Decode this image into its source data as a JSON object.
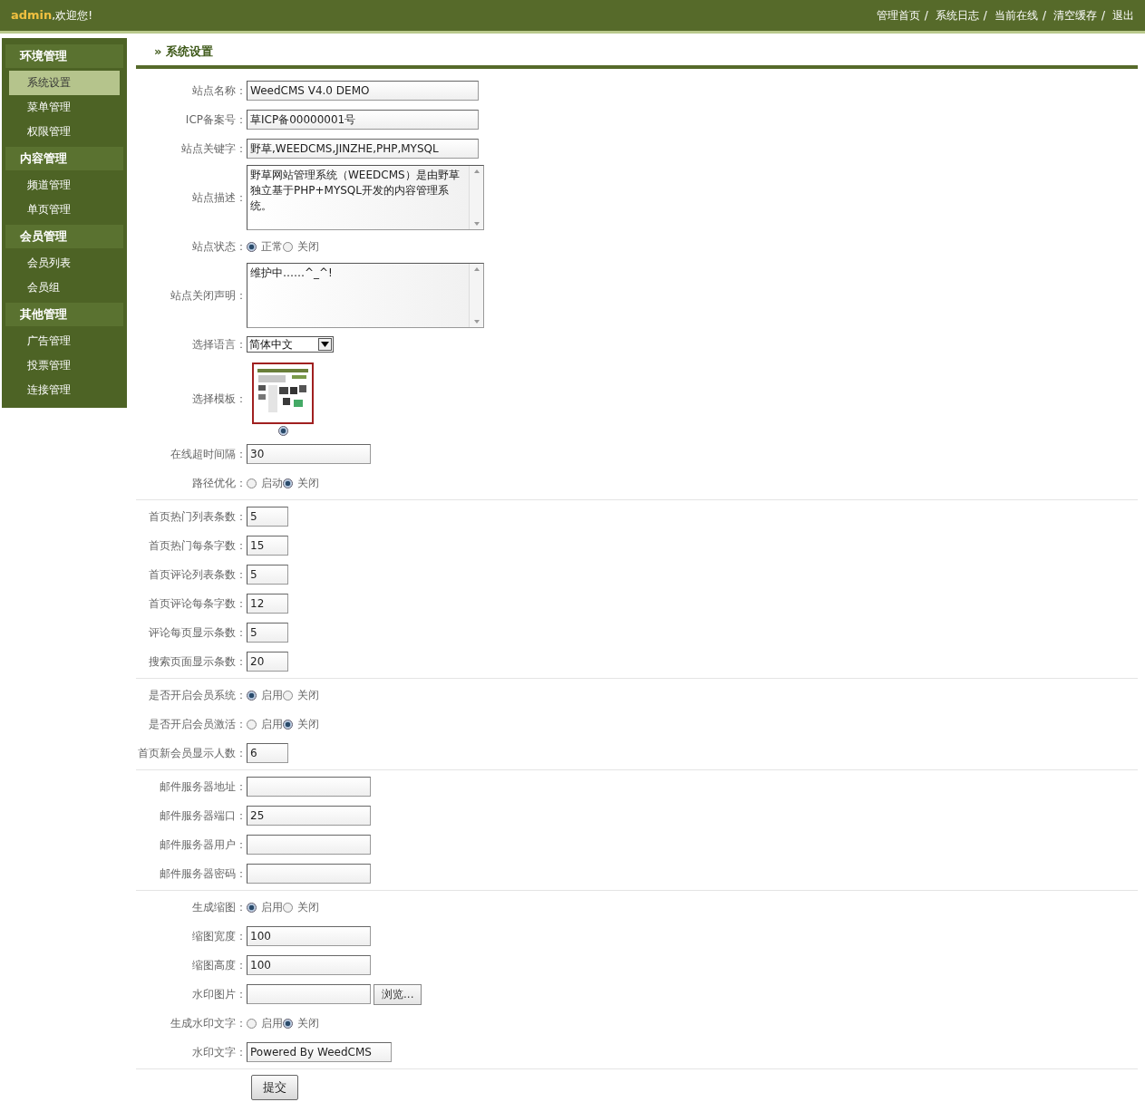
{
  "header": {
    "user": "admin",
    "greeting": ",欢迎您!",
    "links": [
      "管理首页",
      "系统日志",
      "当前在线",
      "清空缓存",
      "退出"
    ],
    "separator": "/"
  },
  "sidebar": {
    "groups": [
      {
        "title": "环境管理",
        "items": [
          {
            "label": "系统设置",
            "selected": true
          },
          {
            "label": "菜单管理",
            "selected": false
          },
          {
            "label": "权限管理",
            "selected": false
          }
        ]
      },
      {
        "title": "内容管理",
        "items": [
          {
            "label": "频道管理",
            "selected": false
          },
          {
            "label": "单页管理",
            "selected": false
          }
        ]
      },
      {
        "title": "会员管理",
        "items": [
          {
            "label": "会员列表",
            "selected": false
          },
          {
            "label": "会员组",
            "selected": false
          }
        ]
      },
      {
        "title": "其他管理",
        "items": [
          {
            "label": "广告管理",
            "selected": false
          },
          {
            "label": "投票管理",
            "selected": false
          },
          {
            "label": "连接管理",
            "selected": false
          }
        ]
      }
    ]
  },
  "page_title": "» 系统设置",
  "sections": [
    {
      "rows": [
        {
          "kind": "text",
          "label": "站点名称：",
          "value": "WeedCMS V4.0 DEMO"
        },
        {
          "kind": "text",
          "label": "ICP备案号：",
          "value": "草ICP备00000001号"
        },
        {
          "kind": "text",
          "label": "站点关键字：",
          "value": "野草,WEEDCMS,JINZHE,PHP,MYSQL"
        },
        {
          "kind": "textarea",
          "label": "站点描述：",
          "value": "野草网站管理系统（WEEDCMS）是由野草独立基于PHP+MYSQL开发的内容管理系统。"
        },
        {
          "kind": "radio",
          "label": "站点状态：",
          "options": [
            {
              "label": "正常",
              "selected": true
            },
            {
              "label": "关闭",
              "selected": false
            }
          ]
        },
        {
          "kind": "textarea",
          "label": "站点关闭声明：",
          "value": "维护中……^_^!"
        },
        {
          "kind": "select",
          "label": "选择语言：",
          "value": "简体中文"
        },
        {
          "kind": "template",
          "label": "选择模板：",
          "options": [
            {
              "selected": true
            }
          ]
        },
        {
          "kind": "text",
          "label": "在线超时间隔：",
          "value": "30"
        },
        {
          "kind": "radio",
          "label": "路径优化：",
          "options": [
            {
              "label": "启动",
              "selected": false
            },
            {
              "label": "关闭",
              "selected": true
            }
          ]
        }
      ]
    },
    {
      "rows": [
        {
          "kind": "text",
          "label": "首页热门列表条数：",
          "value": "5"
        },
        {
          "kind": "text",
          "label": "首页热门每条字数：",
          "value": "15"
        },
        {
          "kind": "text",
          "label": "首页评论列表条数：",
          "value": "5"
        },
        {
          "kind": "text",
          "label": "首页评论每条字数：",
          "value": "12"
        },
        {
          "kind": "text",
          "label": "评论每页显示条数：",
          "value": "5"
        },
        {
          "kind": "text",
          "label": "搜索页面显示条数：",
          "value": "20"
        }
      ]
    },
    {
      "rows": [
        {
          "kind": "radio",
          "label": "是否开启会员系统：",
          "options": [
            {
              "label": "启用",
              "selected": true
            },
            {
              "label": "关闭",
              "selected": false
            }
          ]
        },
        {
          "kind": "radio",
          "label": "是否开启会员激活：",
          "options": [
            {
              "label": "启用",
              "selected": false
            },
            {
              "label": "关闭",
              "selected": true
            }
          ]
        },
        {
          "kind": "text",
          "label": "首页新会员显示人数：",
          "value": "6"
        }
      ]
    },
    {
      "rows": [
        {
          "kind": "text",
          "label": "邮件服务器地址："
        },
        {
          "kind": "text",
          "label": "邮件服务器端口：",
          "value": "25"
        },
        {
          "kind": "text",
          "label": "邮件服务器用户："
        },
        {
          "kind": "text",
          "label": "邮件服务器密码："
        }
      ]
    },
    {
      "rows": [
        {
          "kind": "radio",
          "label": "生成缩图：",
          "options": [
            {
              "label": "启用",
              "selected": true
            },
            {
              "label": "关闭",
              "selected": false
            }
          ]
        },
        {
          "kind": "text",
          "label": "缩图宽度：",
          "value": "100"
        },
        {
          "kind": "text",
          "label": "缩图高度：",
          "value": "100"
        },
        {
          "kind": "file",
          "label": "水印图片：",
          "button": "浏览..."
        },
        {
          "kind": "radio",
          "label": "生成水印文字：",
          "options": [
            {
              "label": "启用",
              "selected": false
            },
            {
              "label": "关闭",
              "selected": true
            }
          ]
        },
        {
          "kind": "text",
          "label": "水印文字：",
          "value": "Powered By WeedCMS"
        }
      ]
    }
  ],
  "submit": "提交"
}
